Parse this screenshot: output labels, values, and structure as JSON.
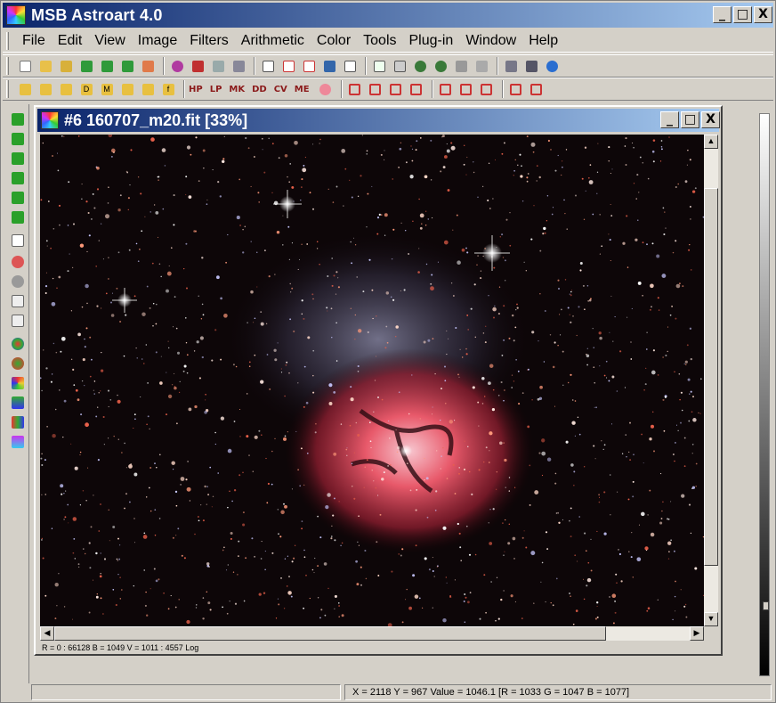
{
  "app": {
    "title": "MSB Astroart 4.0"
  },
  "window_buttons": {
    "minimize": "_",
    "maximize": "□",
    "close": "X"
  },
  "menu": [
    "File",
    "Edit",
    "View",
    "Image",
    "Filters",
    "Arithmetic",
    "Color",
    "Tools",
    "Plug-in",
    "Window",
    "Help"
  ],
  "toolbar2_labels": [
    "HP",
    "LP",
    "MK",
    "DD",
    "CV",
    "ME"
  ],
  "toolbar2_letters": [
    "D",
    "M",
    "f"
  ],
  "child": {
    "title": "#6 160707_m20.fit  [33%]",
    "status": "R = 0 : 66128   B = 1049   V = 1011 : 4557 Log"
  },
  "statusbar": {
    "coords": "X = 2118   Y = 967   Value = 1046.1  [R = 1033  G = 1047  B = 1077]"
  },
  "colors": {
    "titlebar_start": "#0a246a",
    "titlebar_end": "#a6caf0",
    "nebula_core": "#e8596a"
  }
}
